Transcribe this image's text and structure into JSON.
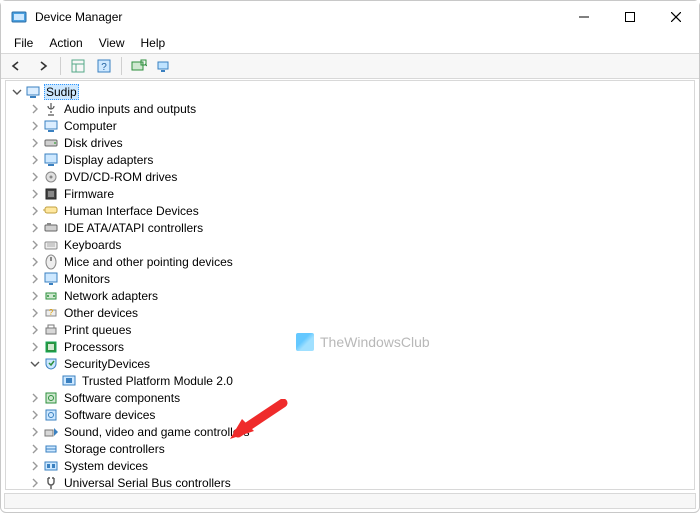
{
  "window": {
    "title": "Device Manager"
  },
  "menus": {
    "file": "File",
    "action": "Action",
    "view": "View",
    "help": "Help"
  },
  "tree": {
    "root": "Sudip",
    "categories": [
      "Audio inputs and outputs",
      "Computer",
      "Disk drives",
      "Display adapters",
      "DVD/CD-ROM drives",
      "Firmware",
      "Human Interface Devices",
      "IDE ATA/ATAPI controllers",
      "Keyboards",
      "Mice and other pointing devices",
      "Monitors",
      "Network adapters",
      "Other devices",
      "Print queues",
      "Processors",
      "SecurityDevices",
      "Software components",
      "Software devices",
      "Sound, video and game controllers",
      "Storage controllers",
      "System devices",
      "Universal Serial Bus controllers"
    ],
    "security_child": "Trusted Platform Module 2.0"
  },
  "watermark": "TheWindowsClub"
}
